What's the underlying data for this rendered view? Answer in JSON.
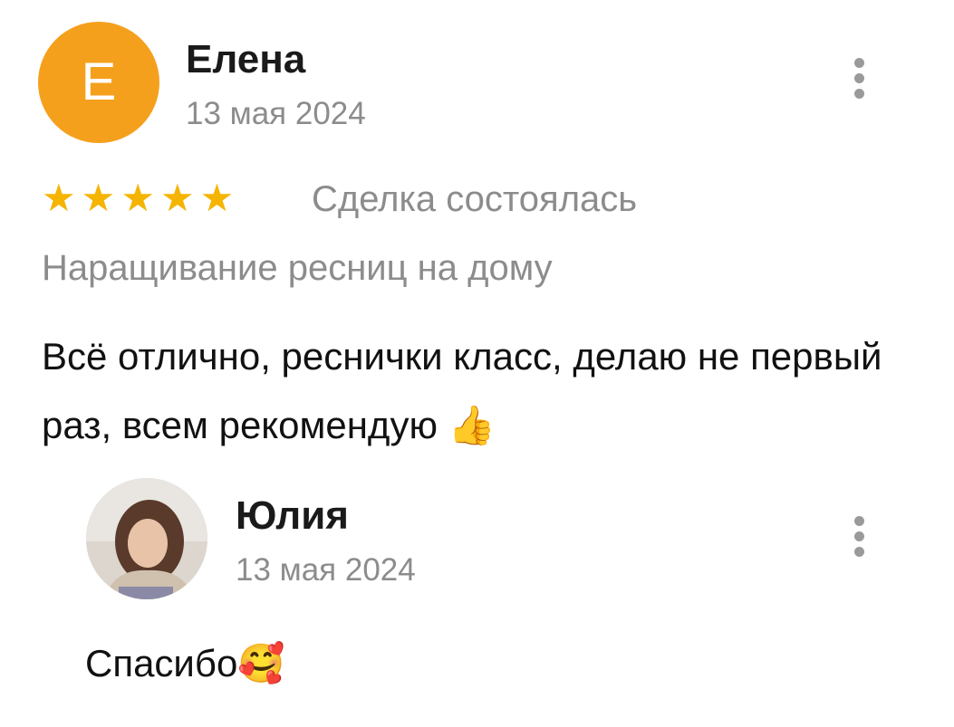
{
  "review": {
    "avatar_letter": "Е",
    "author": "Елена",
    "date": "13 мая 2024",
    "rating": 5,
    "stars": [
      "★",
      "★",
      "★",
      "★",
      "★"
    ],
    "deal_status": "Сделка состоялась",
    "service": "Наращивание ресниц на дому",
    "text_main": "Всё отлично, реснички класс, делаю не первый раз, всем рекомендую",
    "text_emoji": "👍",
    "menu_icon": "more-vertical-icon"
  },
  "reply": {
    "author": "Юлия",
    "date": "13 мая 2024",
    "text_main": "Спасибо",
    "text_emoji": "🥰",
    "menu_icon": "more-vertical-icon"
  },
  "colors": {
    "avatar_bg": "#f5a01c",
    "star": "#f5b400",
    "secondary_text": "#8c8c8c"
  }
}
